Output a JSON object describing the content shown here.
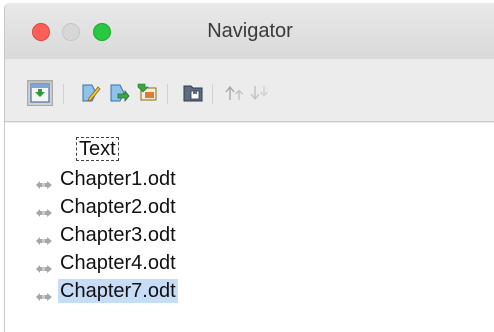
{
  "window": {
    "title": "Navigator"
  },
  "toolbar": {
    "buttons": [
      {
        "icon": "toggle-master-view-icon",
        "pressed": true
      },
      {
        "icon": "edit-icon",
        "pressed": false
      },
      {
        "icon": "update-icon",
        "pressed": false
      },
      {
        "icon": "insert-icon",
        "pressed": false
      },
      {
        "icon": "save-contents-icon",
        "pressed": false
      },
      {
        "icon": "move-up-icon",
        "pressed": false,
        "enabled": false
      },
      {
        "icon": "move-down-icon",
        "pressed": false,
        "enabled": false
      }
    ]
  },
  "tree": {
    "root": "Text",
    "items": [
      {
        "label": "Chapter1.odt",
        "selected": false
      },
      {
        "label": "Chapter2.odt",
        "selected": false
      },
      {
        "label": "Chapter3.odt",
        "selected": false
      },
      {
        "label": "Chapter4.odt",
        "selected": false
      },
      {
        "label": "Chapter7.odt",
        "selected": true
      }
    ]
  },
  "colors": {
    "selection": "#c7dcf7",
    "close": "#fe5f57",
    "zoom": "#28c840"
  }
}
